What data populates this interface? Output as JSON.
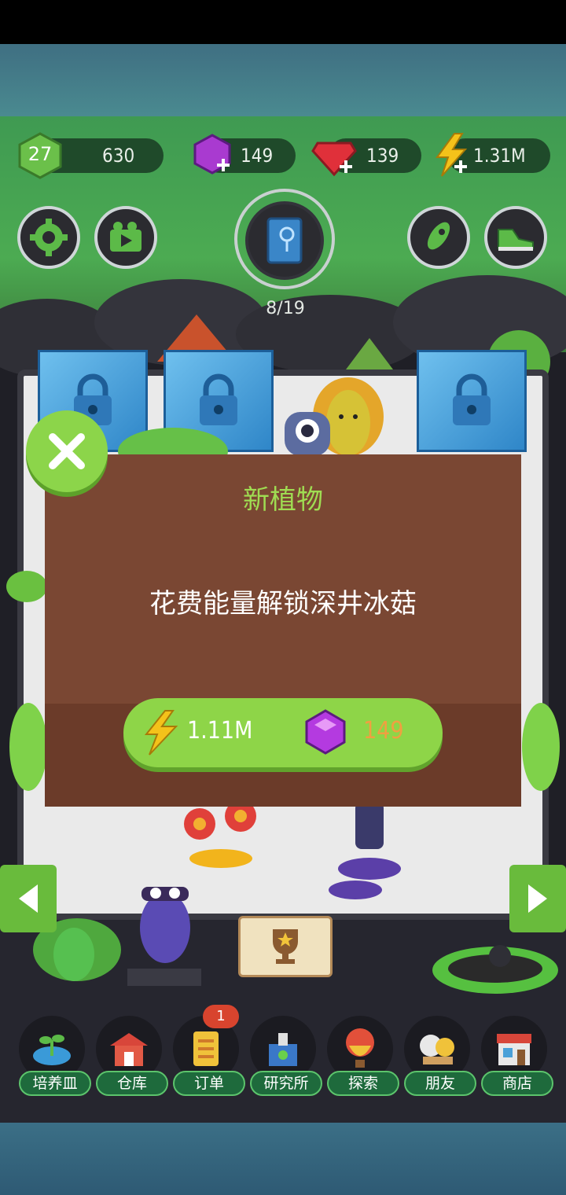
{
  "header": {
    "level": "27",
    "xp": "630",
    "gems_purple": "149",
    "gems_red": "139",
    "energy": "1.31M"
  },
  "progress": {
    "text": "8/19",
    "fraction": 0.42
  },
  "dialog": {
    "title": "新植物",
    "message": "花费能量解锁深井冰菇",
    "energy_cost": "1.11M",
    "gem_cost": "149"
  },
  "orders_badge": "1",
  "nav": [
    {
      "label": "培养皿",
      "icon": "petri-dish-icon"
    },
    {
      "label": "仓库",
      "icon": "barn-icon"
    },
    {
      "label": "订单",
      "icon": "scroll-icon"
    },
    {
      "label": "研究所",
      "icon": "lab-icon"
    },
    {
      "label": "探索",
      "icon": "balloon-icon"
    },
    {
      "label": "朋友",
      "icon": "friends-icon"
    },
    {
      "label": "商店",
      "icon": "shop-icon"
    }
  ],
  "colors": {
    "accent_green": "#8ed548",
    "dialog_brown": "#7a4733",
    "title_green": "#9fdc52",
    "gem_cost_orange": "#f0a040"
  }
}
